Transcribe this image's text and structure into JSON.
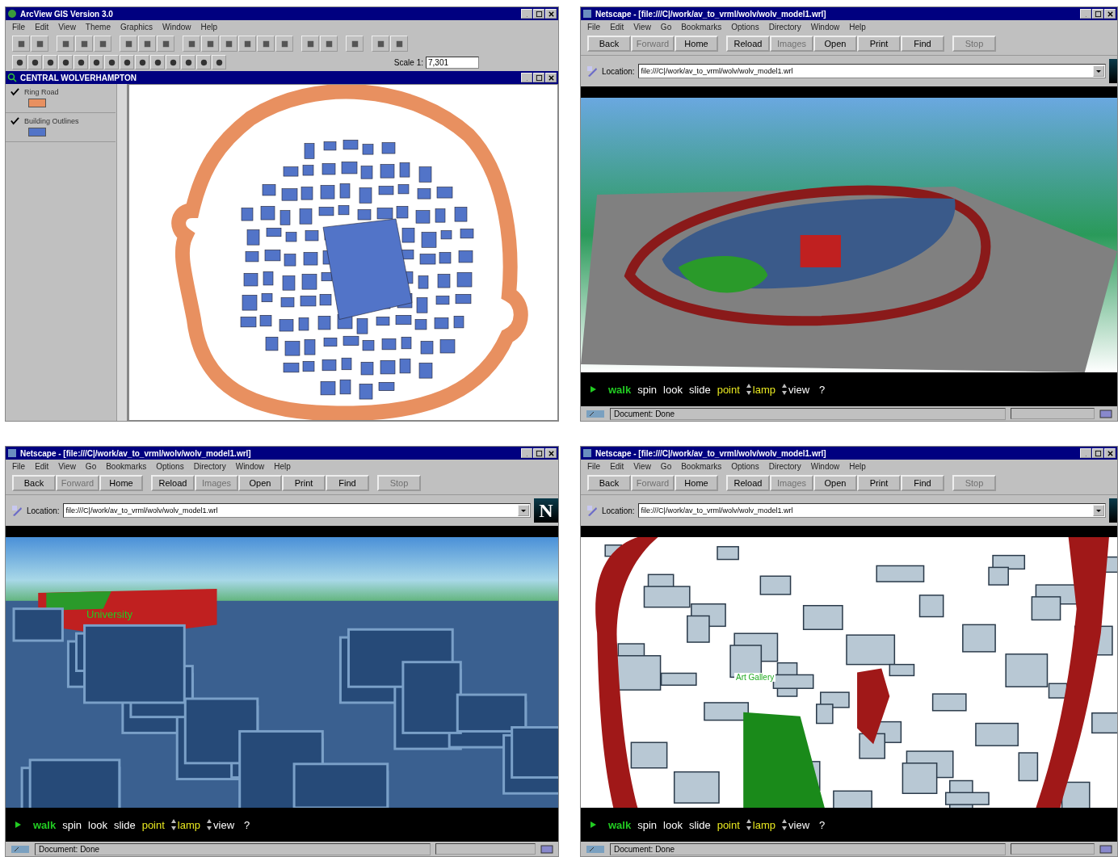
{
  "arcview": {
    "title": "ArcView GIS Version 3.0",
    "menu": [
      "File",
      "Edit",
      "View",
      "Theme",
      "Graphics",
      "Window",
      "Help"
    ],
    "scale_label": "Scale 1:",
    "scale_value": "7,301",
    "view": {
      "title": "CENTRAL WOLVERHAMPTON",
      "legend": [
        {
          "label": "Ring Road",
          "checked": true,
          "color": "#e89060"
        },
        {
          "label": "Building Outlines",
          "checked": true,
          "color": "#5274c8"
        }
      ]
    }
  },
  "browsers": [
    {
      "title": "Netscape - [file:///C|/work/av_to_vrml/wolv/wolv_model1.wrl]",
      "kind": "overview",
      "menu": [
        "File",
        "Edit",
        "View",
        "Go",
        "Bookmarks",
        "Options",
        "Directory",
        "Window",
        "Help"
      ],
      "buttons": [
        {
          "label": "Back",
          "disabled": false
        },
        {
          "label": "Forward",
          "disabled": true
        },
        {
          "label": "Home",
          "disabled": false
        },
        {
          "label": "Reload",
          "disabled": false
        },
        {
          "label": "Images",
          "disabled": true
        },
        {
          "label": "Open",
          "disabled": false
        },
        {
          "label": "Print",
          "disabled": false
        },
        {
          "label": "Find",
          "disabled": false
        },
        {
          "label": "Stop",
          "disabled": true
        }
      ],
      "location_label": "Location:",
      "url": "file:///C|/work/av_to_vrml/wolv/wolv_model1.wrl",
      "nav": [
        {
          "label": "walk",
          "color": "#22cc22",
          "selected": true,
          "kind": "mode"
        },
        {
          "label": "spin",
          "color": "#ffffff",
          "selected": false,
          "kind": "mode"
        },
        {
          "label": "look",
          "color": "#ffffff",
          "selected": false,
          "kind": "mode"
        },
        {
          "label": "slide",
          "color": "#ffffff",
          "selected": false,
          "kind": "mode"
        },
        {
          "label": "point",
          "color": "#e8e820",
          "selected": false,
          "kind": "mode"
        },
        {
          "label": "lamp",
          "color": "#e8e820",
          "selected": false,
          "kind": "toggle"
        },
        {
          "label": "view",
          "color": "#ffffff",
          "selected": false,
          "kind": "toggle"
        },
        {
          "label": "?",
          "color": "#ffffff",
          "selected": false,
          "kind": "help"
        }
      ],
      "status": "Document: Done"
    },
    {
      "title": "Netscape - [file:///C|/work/av_to_vrml/wolv/wolv_model1.wrl]",
      "kind": "street",
      "logo": "N",
      "menu": [
        "File",
        "Edit",
        "View",
        "Go",
        "Bookmarks",
        "Options",
        "Directory",
        "Window",
        "Help"
      ],
      "buttons": [
        {
          "label": "Back",
          "disabled": false
        },
        {
          "label": "Forward",
          "disabled": true
        },
        {
          "label": "Home",
          "disabled": false
        },
        {
          "label": "Reload",
          "disabled": false
        },
        {
          "label": "Images",
          "disabled": true
        },
        {
          "label": "Open",
          "disabled": false
        },
        {
          "label": "Print",
          "disabled": false
        },
        {
          "label": "Find",
          "disabled": false
        },
        {
          "label": "Stop",
          "disabled": true
        }
      ],
      "location_label": "Location:",
      "url": "file:///C|/work/av_to_vrml/wolv/wolv_model1.wrl",
      "scene_labels": [
        {
          "text": "University"
        }
      ],
      "nav": [
        {
          "label": "walk",
          "color": "#22cc22",
          "selected": true,
          "kind": "mode"
        },
        {
          "label": "spin",
          "color": "#ffffff",
          "selected": false,
          "kind": "mode"
        },
        {
          "label": "look",
          "color": "#ffffff",
          "selected": false,
          "kind": "mode"
        },
        {
          "label": "slide",
          "color": "#ffffff",
          "selected": false,
          "kind": "mode"
        },
        {
          "label": "point",
          "color": "#e8e820",
          "selected": false,
          "kind": "mode"
        },
        {
          "label": "lamp",
          "color": "#e8e820",
          "selected": false,
          "kind": "toggle"
        },
        {
          "label": "view",
          "color": "#ffffff",
          "selected": false,
          "kind": "toggle"
        },
        {
          "label": "?",
          "color": "#ffffff",
          "selected": false,
          "kind": "help"
        }
      ],
      "status": "Document: Done"
    },
    {
      "title": "Netscape - [file:///C|/work/av_to_vrml/wolv/wolv_model1.wrl]",
      "kind": "plan",
      "menu": [
        "File",
        "Edit",
        "View",
        "Go",
        "Bookmarks",
        "Options",
        "Directory",
        "Window",
        "Help"
      ],
      "buttons": [
        {
          "label": "Back",
          "disabled": false
        },
        {
          "label": "Forward",
          "disabled": true
        },
        {
          "label": "Home",
          "disabled": false
        },
        {
          "label": "Reload",
          "disabled": false
        },
        {
          "label": "Images",
          "disabled": true
        },
        {
          "label": "Open",
          "disabled": false
        },
        {
          "label": "Print",
          "disabled": false
        },
        {
          "label": "Find",
          "disabled": false
        },
        {
          "label": "Stop",
          "disabled": true
        }
      ],
      "location_label": "Location:",
      "url": "file:///C|/work/av_to_vrml/wolv/wolv_model1.wrl",
      "scene_labels": [
        {
          "text": "Art Gallery"
        }
      ],
      "nav": [
        {
          "label": "walk",
          "color": "#22cc22",
          "selected": true,
          "kind": "mode"
        },
        {
          "label": "spin",
          "color": "#ffffff",
          "selected": false,
          "kind": "mode"
        },
        {
          "label": "look",
          "color": "#ffffff",
          "selected": false,
          "kind": "mode"
        },
        {
          "label": "slide",
          "color": "#ffffff",
          "selected": false,
          "kind": "mode"
        },
        {
          "label": "point",
          "color": "#e8e820",
          "selected": false,
          "kind": "mode"
        },
        {
          "label": "lamp",
          "color": "#e8e820",
          "selected": false,
          "kind": "toggle"
        },
        {
          "label": "view",
          "color": "#ffffff",
          "selected": false,
          "kind": "toggle"
        },
        {
          "label": "?",
          "color": "#ffffff",
          "selected": false,
          "kind": "help"
        }
      ],
      "status": "Document: Done"
    }
  ]
}
